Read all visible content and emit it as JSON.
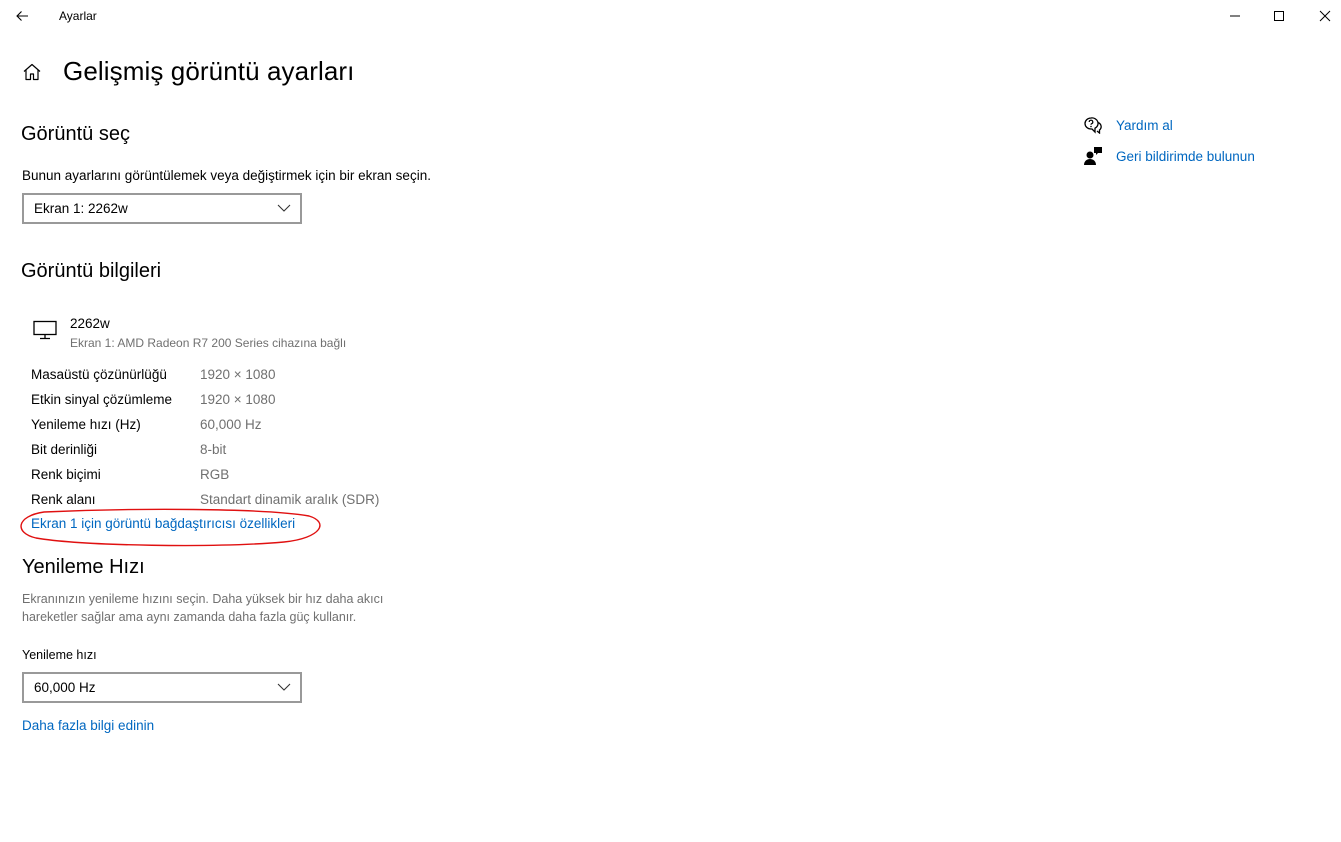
{
  "window": {
    "app_title": "Ayarlar"
  },
  "header": {
    "title": "Gelişmiş görüntü ayarları"
  },
  "select_display": {
    "title": "Görüntü seç",
    "description": "Bunun ayarlarını görüntülemek veya değiştirmek için bir ekran seçin.",
    "selected": "Ekran 1: 2262w"
  },
  "display_info": {
    "title": "Görüntü bilgileri",
    "monitor_name": "2262w",
    "monitor_sub": "Ekran 1: AMD Radeon R7 200 Series cihazına bağlı",
    "rows": [
      {
        "label": "Masaüstü çözünürlüğü",
        "value": "1920 × 1080"
      },
      {
        "label": "Etkin sinyal çözümleme",
        "value": "1920 × 1080"
      },
      {
        "label": "Yenileme hızı (Hz)",
        "value": "60,000 Hz"
      },
      {
        "label": "Bit derinliği",
        "value": "8-bit"
      },
      {
        "label": "Renk biçimi",
        "value": "RGB"
      },
      {
        "label": "Renk alanı",
        "value": "Standart dinamik aralık (SDR)"
      }
    ],
    "adapter_link": "Ekran 1 için görüntü bağdaştırıcısı özellikleri"
  },
  "refresh_rate": {
    "title": "Yenileme Hızı",
    "description": "Ekranınızın yenileme hızını seçin. Daha yüksek bir hız daha akıcı hareketler sağlar ama aynı zamanda daha fazla güç kullanır.",
    "label": "Yenileme hızı",
    "selected": "60,000 Hz",
    "more_info_link": "Daha fazla bilgi edinin"
  },
  "side": {
    "help": "Yardım al",
    "feedback": "Geri bildirimde bulunun"
  },
  "colors": {
    "accent_link": "#0067c0",
    "secondary_text": "#707070",
    "annotation": "#e01010"
  },
  "icons": [
    "back-arrow-icon",
    "minimize-icon",
    "maximize-icon",
    "close-icon",
    "home-icon",
    "chevron-down-icon",
    "monitor-icon",
    "help-icon",
    "feedback-icon"
  ]
}
